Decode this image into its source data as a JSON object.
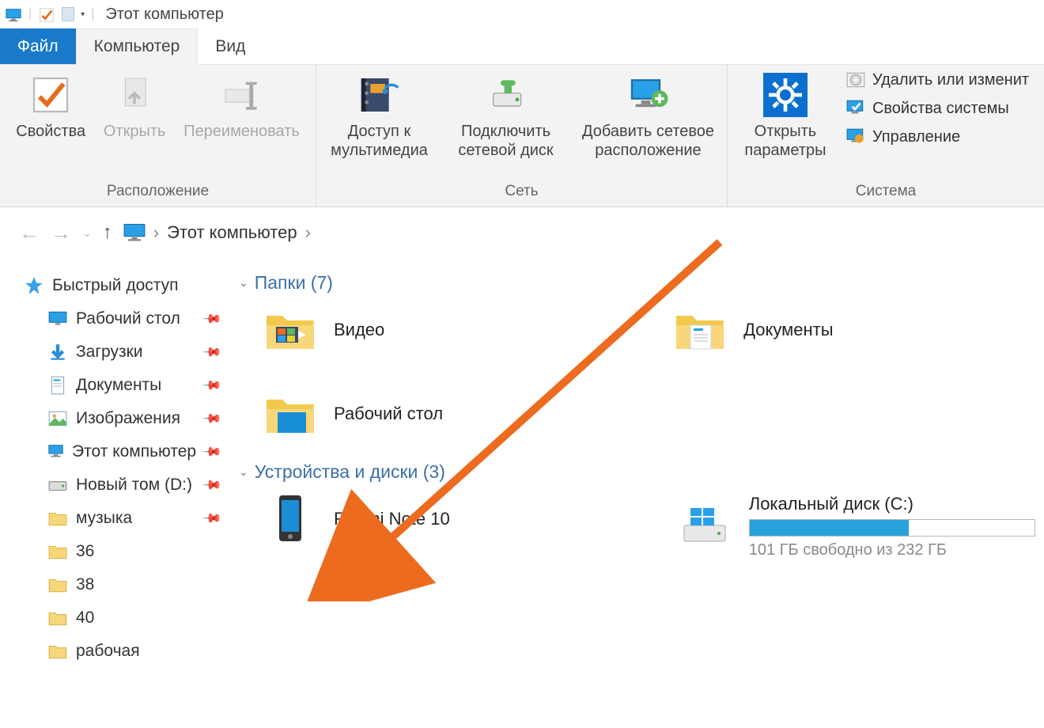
{
  "title": "Этот компьютер",
  "tabs": {
    "file": "Файл",
    "computer": "Компьютер",
    "view": "Вид"
  },
  "ribbon": {
    "location": {
      "caption": "Расположение",
      "props": "Свойства",
      "open": "Открыть",
      "rename": "Переименовать"
    },
    "network": {
      "caption": "Сеть",
      "media": "Доступ к\nмультимедиа",
      "mapdrive": "Подключить\nсетевой диск",
      "addloc": "Добавить сетевое\nрасположение"
    },
    "system": {
      "caption": "Система",
      "params": "Открыть\nпараметры",
      "remove": "Удалить или изменит",
      "sysprops": "Свойства системы",
      "manage": "Управление"
    }
  },
  "breadcrumb": "Этот компьютер",
  "sidebar": {
    "quick": "Быстрый доступ",
    "items": [
      {
        "label": "Рабочий стол",
        "pin": true,
        "icon": "desktop"
      },
      {
        "label": "Загрузки",
        "pin": true,
        "icon": "down"
      },
      {
        "label": "Документы",
        "pin": true,
        "icon": "docs"
      },
      {
        "label": "Изображения",
        "pin": true,
        "icon": "pics"
      },
      {
        "label": "Этот компьютер",
        "pin": true,
        "icon": "pc"
      },
      {
        "label": "Новый том (D:)",
        "pin": true,
        "icon": "hdd"
      },
      {
        "label": "музыка",
        "pin": true,
        "icon": "folder"
      },
      {
        "label": "36",
        "pin": false,
        "icon": "folder"
      },
      {
        "label": "38",
        "pin": false,
        "icon": "folder"
      },
      {
        "label": "40",
        "pin": false,
        "icon": "folder"
      },
      {
        "label": "рабочая",
        "pin": false,
        "icon": "folder"
      }
    ]
  },
  "sections": {
    "folders": {
      "title": "Папки (7)",
      "video": "Видео",
      "documents": "Документы",
      "desktop": "Рабочий стол"
    },
    "devices": {
      "title": "Устройства и диски (3)",
      "phone": "Redmi Note 10",
      "drive": {
        "name": "Локальный диск (C:)",
        "free_text": "101 ГБ свободно из 232 ГБ",
        "fill_pct": 56
      }
    }
  }
}
